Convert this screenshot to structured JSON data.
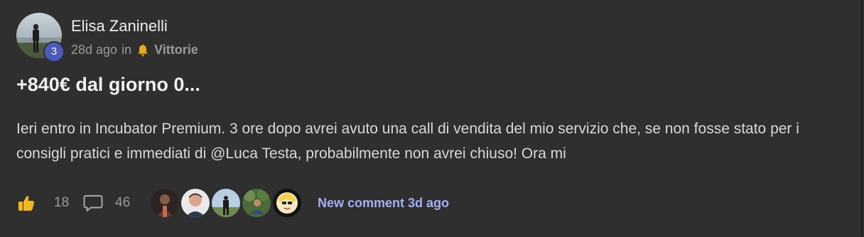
{
  "post": {
    "author_name": "Elisa Zaninelli",
    "level": "3",
    "time_ago": "28d ago",
    "in_word": "in",
    "category_icon": "bell-icon",
    "category": "Vittorie",
    "title": "+840€ dal giorno 0...",
    "body": "Ieri entro in Incubator Premium. 3 ore dopo avrei avuto una call di vendita del mio servizio che, se non fosse stato per i consigli pratici e immediati di @Luca Testa, probabilmente non avrei chiuso! Ora mi"
  },
  "footer": {
    "like_icon": "thumbs-up-icon",
    "likes": "18",
    "comment_icon": "speech-bubble-icon",
    "comments": "46",
    "participant_count": 5,
    "new_comment": "New comment 3d ago"
  },
  "colors": {
    "background": "#2f2f30",
    "level_badge": "#4a5bbd",
    "link": "#a4b0ef",
    "like_icon": "#f2b71b"
  }
}
